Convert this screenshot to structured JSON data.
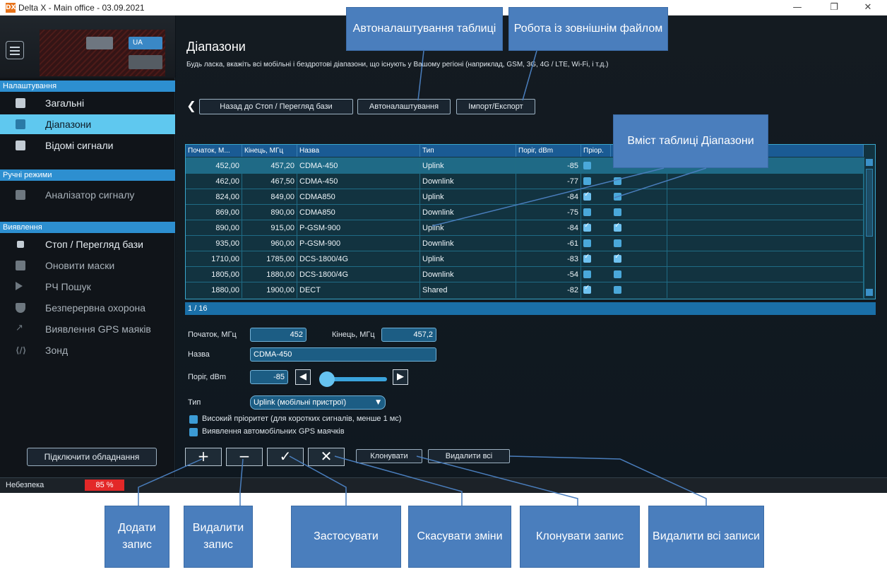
{
  "window": {
    "logo": "DX",
    "title": "Delta X - Main office - 03.09.2021",
    "controls": [
      "—",
      "❐",
      "✕"
    ]
  },
  "sidebar": {
    "lang": "UA",
    "sections": [
      {
        "header": "Налаштування",
        "items": [
          {
            "label": "Загальні",
            "icon": "gear-icon"
          },
          {
            "label": "Діапазони",
            "icon": "list-icon"
          },
          {
            "label": "Відомі сигнали",
            "icon": "document-icon"
          }
        ]
      },
      {
        "header": "Ручні режими",
        "items": [
          {
            "label": "Аналізатор сигналу",
            "icon": "diamond-icon"
          }
        ]
      },
      {
        "header": "Виявлення",
        "items": [
          {
            "label": "Стоп / Перегляд бази",
            "icon": "stop-icon"
          },
          {
            "label": "Оновити маски",
            "icon": "image-icon"
          },
          {
            "label": "РЧ Пошук",
            "icon": "play-icon"
          },
          {
            "label": "Безперервна охорона",
            "icon": "shield-icon"
          },
          {
            "label": "Виявлення GPS маяків",
            "icon": "trend-icon"
          },
          {
            "label": "Зонд",
            "icon": "probe-icon"
          }
        ]
      }
    ],
    "connect_button": "Підключити обладнання",
    "danger_label": "Небезпека",
    "danger_value": "85 %"
  },
  "main": {
    "title": "Діапазони",
    "subtitle": "Будь ласка, вкажіть всі мобільні і бездротові діапазони, що існують у Вашому регіоні (наприклад, GSM, 3G, 4G / LTE, Wi-Fi, і т.д.)",
    "toolbar": {
      "back": "Назад до Стоп / Перегляд бази",
      "auto": "Автоналаштування",
      "import": "Імпорт/Експорт"
    },
    "table": {
      "columns": [
        "Початок, М...",
        "Кінець, МГц",
        "Назва",
        "Тип",
        "Поріг, dBm",
        "Пріор.",
        "",
        ""
      ],
      "rows": [
        {
          "start": "452,00",
          "end": "457,20",
          "name": "CDMA-450",
          "type": "Uplink",
          "thr": "-85",
          "prio": false,
          "gps": null
        },
        {
          "start": "462,00",
          "end": "467,50",
          "name": "CDMA-450",
          "type": "Downlink",
          "thr": "-77",
          "prio": false,
          "gps": false
        },
        {
          "start": "824,00",
          "end": "849,00",
          "name": "CDMA850",
          "type": "Uplink",
          "thr": "-84",
          "prio": true,
          "gps": false
        },
        {
          "start": "869,00",
          "end": "890,00",
          "name": "CDMA850",
          "type": "Downlink",
          "thr": "-75",
          "prio": false,
          "gps": false
        },
        {
          "start": "890,00",
          "end": "915,00",
          "name": "P-GSM-900",
          "type": "Uplink",
          "thr": "-84",
          "prio": true,
          "gps": true
        },
        {
          "start": "935,00",
          "end": "960,00",
          "name": "P-GSM-900",
          "type": "Downlink",
          "thr": "-61",
          "prio": false,
          "gps": false
        },
        {
          "start": "1710,00",
          "end": "1785,00",
          "name": "DCS-1800/4G",
          "type": "Uplink",
          "thr": "-83",
          "prio": true,
          "gps": true
        },
        {
          "start": "1805,00",
          "end": "1880,00",
          "name": "DCS-1800/4G",
          "type": "Downlink",
          "thr": "-54",
          "prio": false,
          "gps": false
        },
        {
          "start": "1880,00",
          "end": "1900,00",
          "name": "DECT",
          "type": "Shared",
          "thr": "-82",
          "prio": true,
          "gps": false
        }
      ],
      "pager": "1 / 16"
    },
    "form": {
      "start_label": "Початок, МГц",
      "start_value": "452",
      "end_label": "Кінець, МГц",
      "end_value": "457,2",
      "name_label": "Назва",
      "name_value": "CDMA-450",
      "thr_label": "Поріг, dBm",
      "thr_value": "-85",
      "slider_level": 0.0,
      "type_label": "Тип",
      "type_value": "Uplink (мобільні пристрої)",
      "check_priority": "Високий пріоритет (для коротких сигналів, менше 1 мс)",
      "check_gps": "Виявлення автомобільних GPS маячків"
    },
    "bottom": {
      "add": "+",
      "remove": "−",
      "apply": "✓",
      "cancel": "✕",
      "clone": "Клонувати",
      "delete_all": "Видалити всі"
    }
  },
  "callouts": {
    "auto_table": "Автоналаштування таблиці",
    "external_file": "Робота із зовнішнім файлом",
    "table_content": "Вміст таблиці Діапазони",
    "add_record": "Додати запис",
    "delete_record": "Видалити запис",
    "apply": "Застосувати",
    "cancel_changes": "Скасувати зміни",
    "clone_record": "Клонувати запис",
    "delete_all_records": "Видалити всі записи"
  },
  "colors": {
    "accent": "#2d8fd0",
    "active_nav": "#5fc8ef",
    "callout": "#4a7ebd",
    "danger": "#e32828"
  }
}
